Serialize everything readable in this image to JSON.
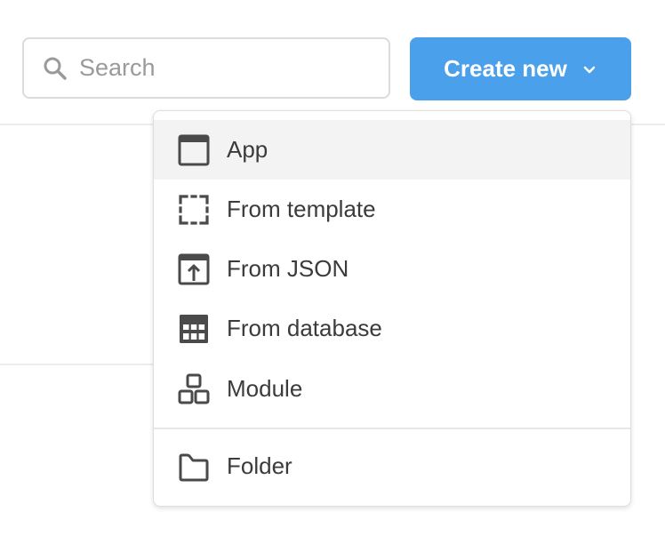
{
  "search": {
    "placeholder": "Search",
    "icon": "search-icon"
  },
  "create_button": {
    "label": "Create new",
    "icon": "chevron-down-icon",
    "color": "#4aa0ea"
  },
  "menu": {
    "items": [
      {
        "label": "App",
        "icon": "app-window-icon",
        "highlighted": true
      },
      {
        "label": "From template",
        "icon": "template-frame-icon"
      },
      {
        "label": "From JSON",
        "icon": "import-json-icon"
      },
      {
        "label": "From database",
        "icon": "database-table-icon"
      },
      {
        "label": "Module",
        "icon": "module-blocks-icon"
      },
      {
        "label": "Folder",
        "icon": "folder-icon"
      }
    ]
  }
}
